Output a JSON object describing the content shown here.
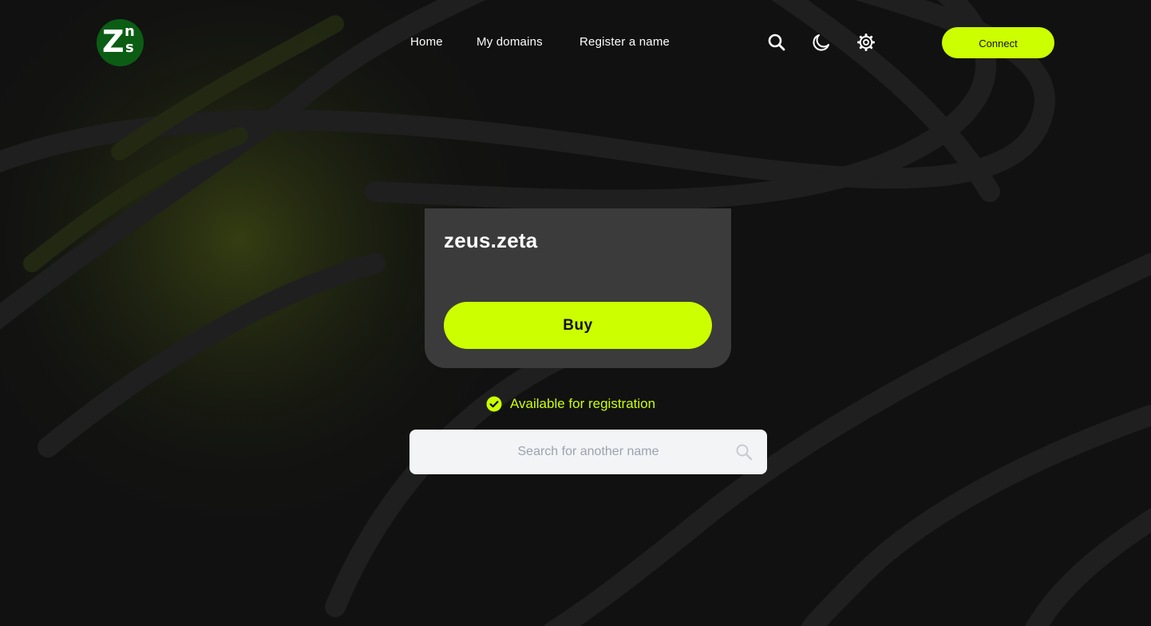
{
  "brand": {
    "logo_letters": {
      "big": "Z",
      "top": "n",
      "bottom": "s"
    },
    "logo_color": "#0b5d14"
  },
  "nav": {
    "links": [
      {
        "label": "Home"
      },
      {
        "label": "My domains"
      },
      {
        "label": "Register a name"
      }
    ],
    "icons": [
      "search-icon",
      "moon-icon",
      "gear-icon"
    ],
    "connect_label": "Connect"
  },
  "domain_card": {
    "name": "zeus.zeta",
    "buy_label": "Buy"
  },
  "availability": {
    "text": "Available for registration",
    "icon": "check-circle-icon"
  },
  "search": {
    "placeholder": "Search for another name",
    "value": ""
  },
  "colors": {
    "accent": "#ccff00",
    "background": "#111111",
    "card": "#3b3b3b",
    "search_bg": "#f3f4f6"
  }
}
